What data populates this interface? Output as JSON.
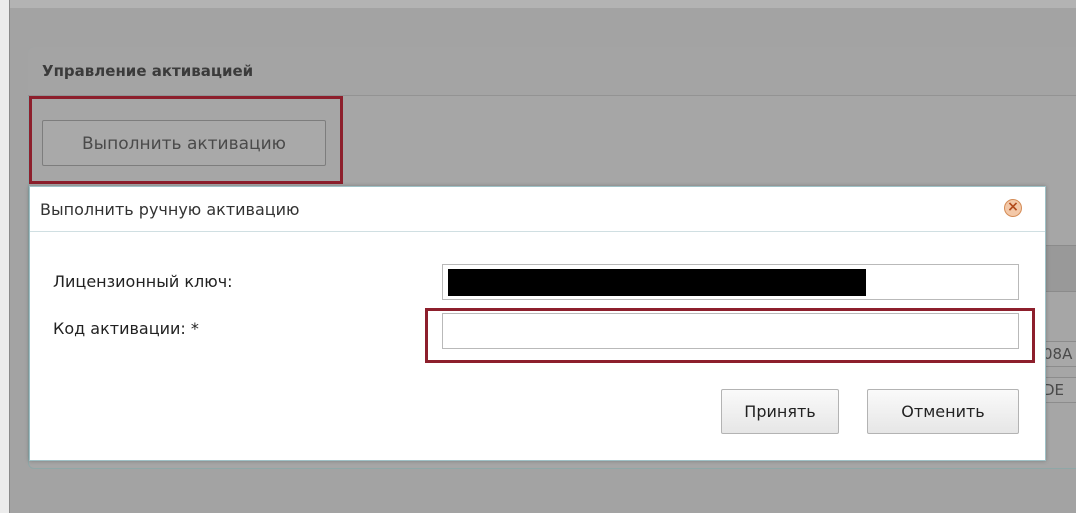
{
  "panel": {
    "title": "Управление активацией",
    "activate_button": "Выполнить активацию",
    "partial_values": [
      "08A",
      "DE"
    ]
  },
  "dialog": {
    "title": "Выполнить ручную активацию",
    "close_icon": "close-icon",
    "license_key_label": "Лицензионный ключ:",
    "license_key_value": "",
    "activation_code_label": "Код активации: *",
    "activation_code_value": "",
    "accept_button": "Принять",
    "cancel_button": "Отменить"
  },
  "colors": {
    "highlight": "#8d1f2c",
    "dialog_border": "#9fc1c6",
    "overlay": "#a3a3a3"
  }
}
